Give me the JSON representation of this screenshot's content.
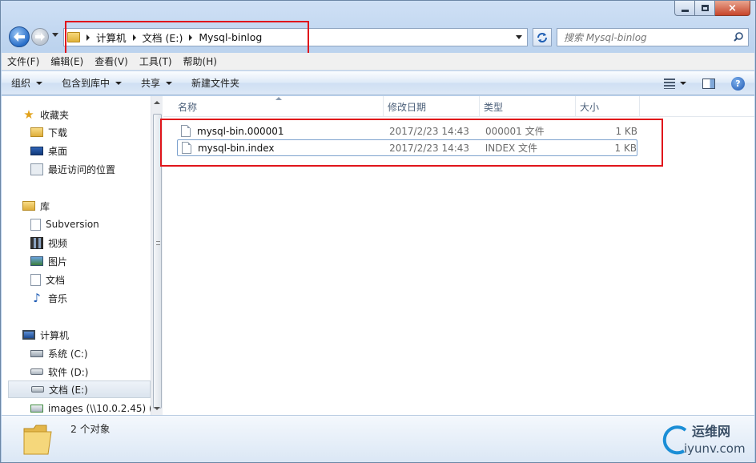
{
  "window": {
    "min_glyph": "minimize-icon",
    "max_glyph": "maximize-icon",
    "close_glyph": "×"
  },
  "address": {
    "crumbs": [
      "计算机",
      "文档 (E:)",
      "Mysql-binlog"
    ]
  },
  "search": {
    "placeholder": "搜索 Mysql-binlog"
  },
  "menu": [
    "文件(F)",
    "编辑(E)",
    "查看(V)",
    "工具(T)",
    "帮助(H)"
  ],
  "toolbar": {
    "organize": "组织",
    "include_library": "包含到库中",
    "share": "共享",
    "new_folder": "新建文件夹"
  },
  "nav": {
    "favorites": "收藏夹",
    "downloads": "下载",
    "desktop": "桌面",
    "recent": "最近访问的位置",
    "libraries": "库",
    "subversion": "Subversion",
    "videos": "视频",
    "pictures": "图片",
    "documents": "文档",
    "music": "音乐",
    "computer": "计算机",
    "drive_c": "系统 (C:)",
    "drive_d": "软件 (D:)",
    "drive_e": "文档 (E:)",
    "network_drive": "images (\\\\10.0.2.45) (V"
  },
  "columns": {
    "name": "名称",
    "date": "修改日期",
    "type": "类型",
    "size": "大小"
  },
  "files": [
    {
      "name": "mysql-bin.000001",
      "date": "2017/2/23 14:43",
      "type": "000001 文件",
      "size": "1 KB"
    },
    {
      "name": "mysql-bin.index",
      "date": "2017/2/23 14:43",
      "type": "INDEX 文件",
      "size": "1 KB"
    }
  ],
  "status": {
    "count": "2 个对象"
  },
  "watermark": {
    "cn": "运维网",
    "url": "iyunv.com"
  },
  "colors": {
    "highlight_box": "#e0151b",
    "accent": "#1f5fb4"
  }
}
